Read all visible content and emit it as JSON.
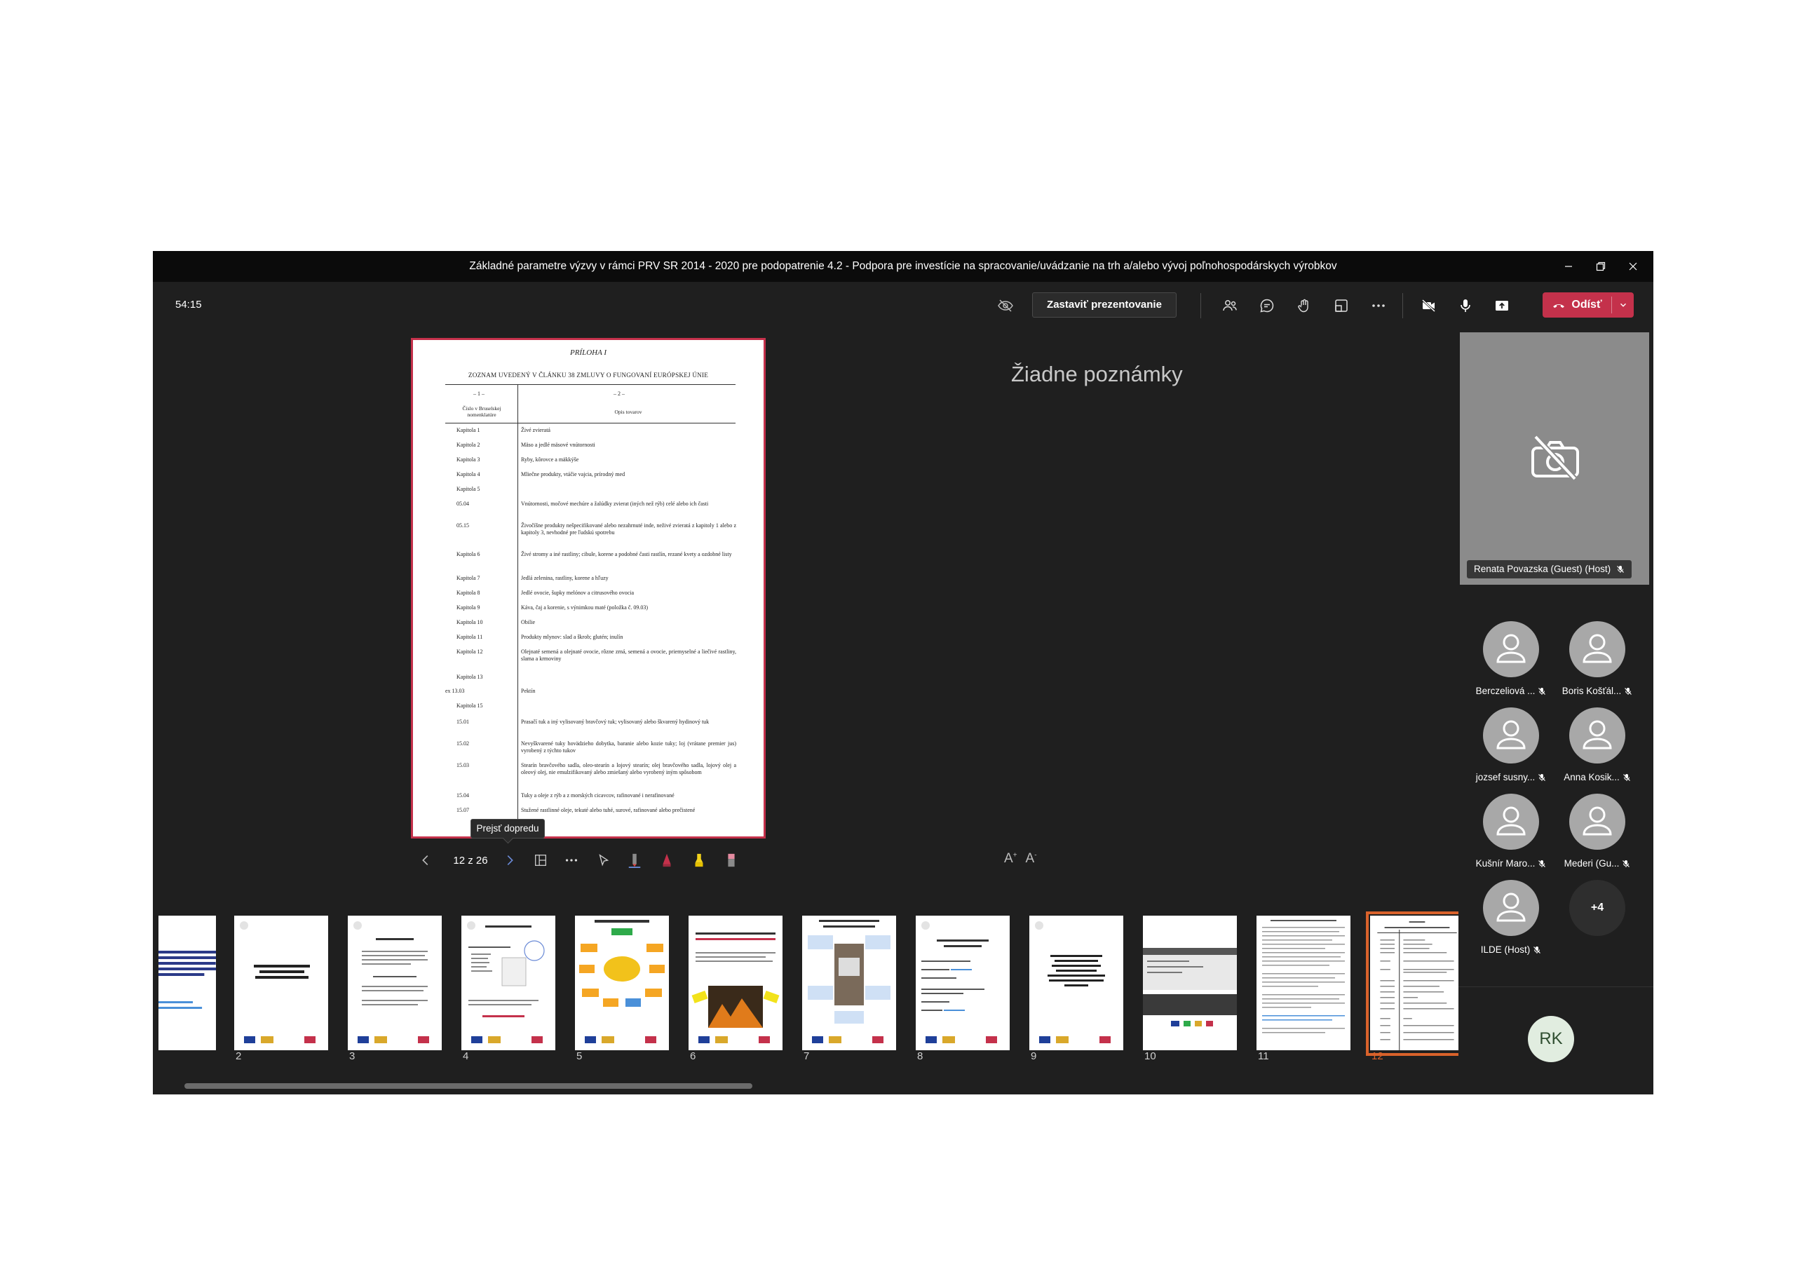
{
  "window": {
    "title": "Základné parametre výzvy v rámci PRV SR 2014 - 2020 pre podopatrenie 4.2 - Podpora pre investície na spracovanie/uvádzanie na trh a/alebo vývoj poľnohospodárskych výrobkov"
  },
  "toolbar": {
    "timer": "54:15",
    "stop_presenting_label": "Zastaviť prezentovanie",
    "leave_label": "Odísť",
    "accent_color": "#c4314b"
  },
  "slide": {
    "title": "PRÍLOHA I",
    "subtitle": "ZOZNAM UVEDENÝ V ČLÁNKU 38 ZMLUVY O FUNGOVANÍ EURÓPSKEJ ÚNIE",
    "col1_num": "– 1 –",
    "col2_num": "– 2 –",
    "col1_head": "Číslo v Bruselskej nomenklatúre",
    "col2_head": "Opis tovarov",
    "rows": [
      {
        "code": "Kapitola 1",
        "desc": "Živé zvieratá"
      },
      {
        "code": "Kapitola 2",
        "desc": "Mäso a jedlé mäsové vnútornosti"
      },
      {
        "code": "Kapitola 3",
        "desc": "Ryby, kôrovce a mäkkýše"
      },
      {
        "code": "Kapitola 4",
        "desc": "Mliečne produkty, vtáčie vajcia, prírodný med"
      },
      {
        "code": "Kapitola 5",
        "desc": ""
      },
      {
        "code": "05.04",
        "desc": "Vnútornosti, močové mechúre a žalúdky zvierat (iných než rýb) celé alebo ich časti"
      },
      {
        "code": "05.15",
        "desc": "Živočíšne produkty nešpecifikované alebo nezahrnuté inde, neživé zvieratá z kapitoly 1 alebo z kapitoly 3, nevhodné pre ľudskú spotrebu"
      },
      {
        "code": "Kapitola 6",
        "desc": "Živé stromy a iné rastliny; cibule, korene a podobné časti rastlín, rezané kvety a ozdobné listy"
      },
      {
        "code": "Kapitola 7",
        "desc": "Jedlá zelenina, rastliny, korene a hľuzy"
      },
      {
        "code": "Kapitola 8",
        "desc": "Jedlé ovocie, šupky melónov a citrusového ovocia"
      },
      {
        "code": "Kapitola 9",
        "desc": "Káva, čaj a korenie, s výnimkou maté (položka č. 09.03)"
      },
      {
        "code": "Kapitola 10",
        "desc": "Obilie"
      },
      {
        "code": "Kapitola 11",
        "desc": "Produkty mlynov: slad a škrob; glutén; inulín"
      },
      {
        "code": "Kapitola 12",
        "desc": "Olejnaté semená a olejnaté ovocie, rôzne zrná, semená a ovocie, priemyselné a liečivé rastliny, slama a krmoviny"
      },
      {
        "code": "Kapitola 13",
        "desc": ""
      },
      {
        "code": "ex 13.03",
        "desc": "Pektín"
      },
      {
        "code": "Kapitola 15",
        "desc": ""
      },
      {
        "code": "15.01",
        "desc": "Prasačí tuk a iný vylisovaný bravčový tuk; vylisovaný alebo škvarený hydinový tuk"
      },
      {
        "code": "15.02",
        "desc": "Nevyškvarené tuky hovädzieho dobytka, baranie alebo kozie tuky; loj (vrátane premier jus) vyrobený z týchto tukov"
      },
      {
        "code": "15.03",
        "desc": "Stearín bravčového sadla, oleo-stearín a lojový stearín; olej bravčového sadla, lojový olej a oleový olej, nie emulzifikovaný alebo zmiešaný alebo vyrobený iným spôsobom"
      },
      {
        "code": "15.04",
        "desc": "Tuky a oleje z rýb a z morských cicavcov, rafinované i nerafinované"
      },
      {
        "code": "15.07",
        "desc": "Stužené rastlinné oleje, tekuté alebo tuhé, surové, rafinované alebo prečistené"
      }
    ]
  },
  "slide_controls": {
    "tooltip": "Prejsť dopredu",
    "page_counter": "12 z 26"
  },
  "notes": {
    "empty_text": "Žiadne poznámky"
  },
  "thumbnails": {
    "numbers": [
      "2",
      "3",
      "4",
      "5",
      "6",
      "7",
      "8",
      "9",
      "10",
      "11",
      "12"
    ],
    "selected": "12",
    "highlight_color": "#d9622b"
  },
  "sidebar": {
    "featured_name": "Renata Povazska (Guest) (Host)",
    "participants": [
      {
        "name": "Berczeliová ..."
      },
      {
        "name": "Boris Košťál..."
      },
      {
        "name": "jozsef susny..."
      },
      {
        "name": "Anna Kosik..."
      },
      {
        "name": "Kušnír Maro..."
      },
      {
        "name": "Mederi (Gu..."
      },
      {
        "name": "ILDE (Host)"
      }
    ],
    "more_count": "+4",
    "self_initials": "RK"
  }
}
